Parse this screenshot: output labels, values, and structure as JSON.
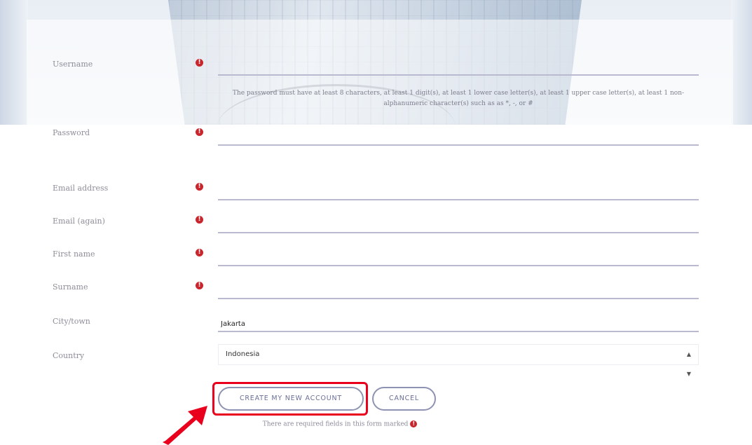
{
  "form": {
    "password_help": "The password must have at least 8 characters, at least 1 digit(s), at least 1 lower case letter(s), at least 1 upper case letter(s), at least 1 non-alphanumeric character(s) such as as *, -, or #",
    "required_icon": "exclamation-circle-icon",
    "fields": {
      "username": {
        "label": "Username",
        "value": ""
      },
      "password": {
        "label": "Password",
        "value": ""
      },
      "email": {
        "label": "Email address",
        "value": ""
      },
      "email_again": {
        "label": "Email (again)",
        "value": ""
      },
      "first_name": {
        "label": "First name",
        "value": ""
      },
      "surname": {
        "label": "Surname",
        "value": ""
      },
      "city": {
        "label": "City/town",
        "value": "Jakarta"
      },
      "country": {
        "label": "Country",
        "value": "Indonesia"
      }
    }
  },
  "buttons": {
    "create": "CREATE MY NEW ACCOUNT",
    "cancel": "CANCEL"
  },
  "footer": {
    "required_note": "There are required fields in this form marked"
  },
  "colors": {
    "required": "#c9252c",
    "annotation": "#e8001d",
    "button_border": "#8e93b3"
  }
}
